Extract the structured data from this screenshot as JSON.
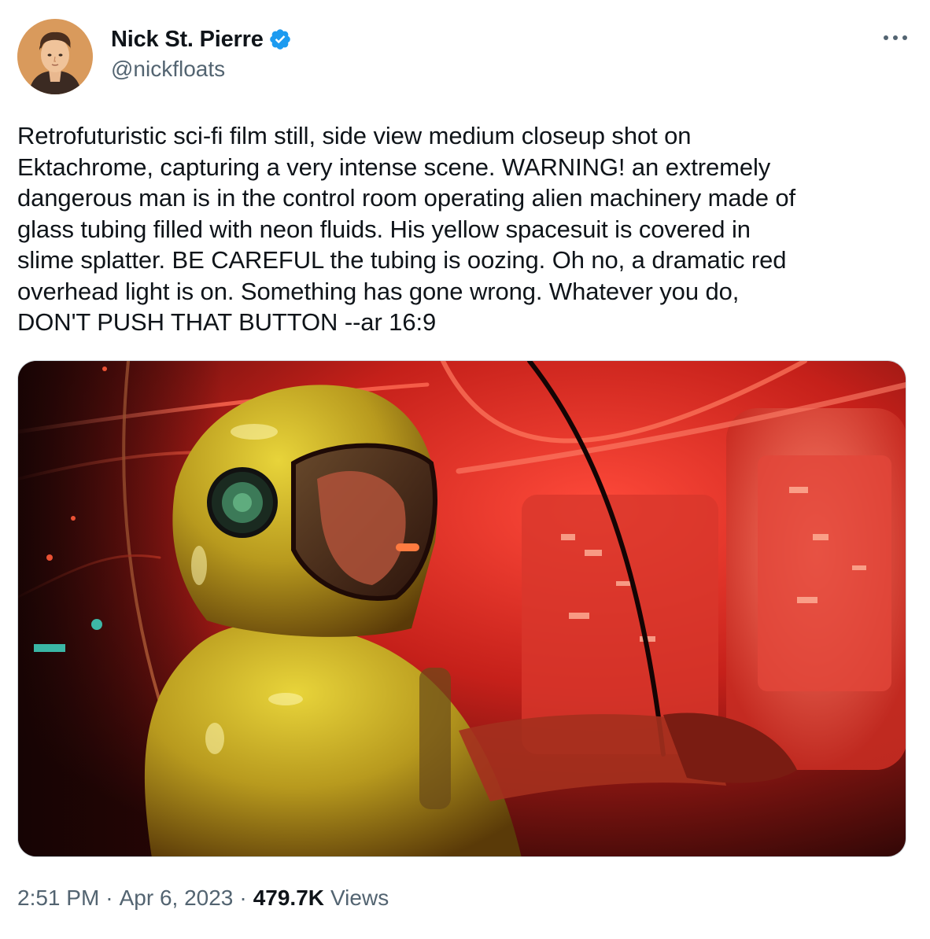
{
  "author": {
    "display_name": "Nick St. Pierre",
    "handle": "@nickfloats",
    "verified": true,
    "verified_icon": "verified-badge-icon",
    "verified_color": "#1d9bf0"
  },
  "more_icon": "more-dots-icon",
  "tweet": {
    "text": "Retrofuturistic sci-fi film still, side view medium closeup shot on\nEktachrome, capturing a very intense scene. WARNING! an extremely\ndangerous man is in the control room operating alien machinery made of\nglass tubing filled with neon fluids. His yellow spacesuit is covered in\nslime splatter. BE CAREFUL the tubing is oozing. Oh no, a dramatic red\noverhead light is on. Something has gone wrong. Whatever you do,\nDON'T PUSH THAT BUTTON --ar 16:9"
  },
  "meta": {
    "time": "2:51 PM",
    "separator": "·",
    "date": "Apr 6, 2023",
    "views_count": "479.7K",
    "views_label": "Views"
  },
  "colors": {
    "text_primary": "#0f1419",
    "text_secondary": "#536471",
    "border": "#cfd9de"
  }
}
